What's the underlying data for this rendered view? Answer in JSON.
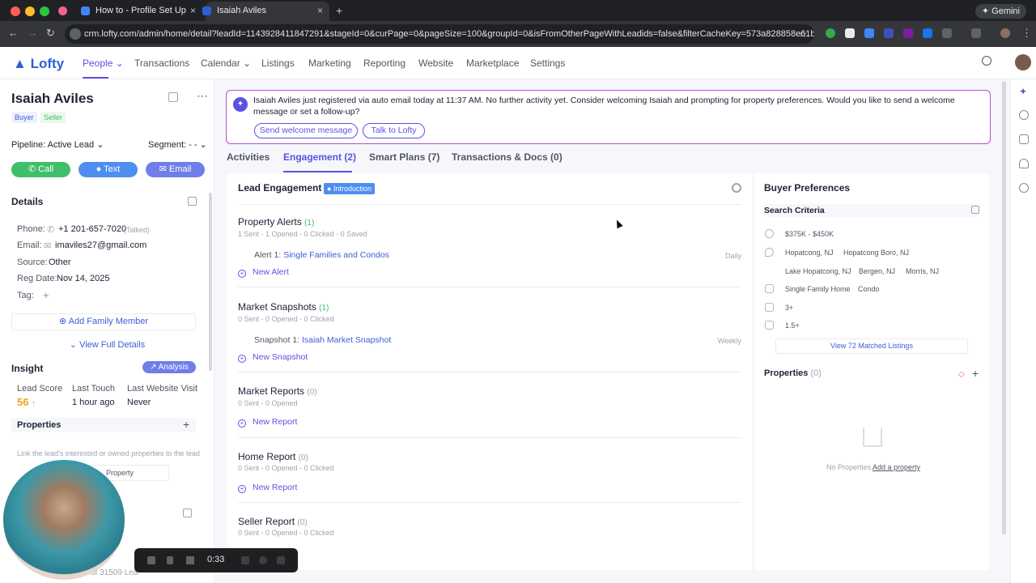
{
  "browser": {
    "tabs": [
      {
        "label": ""
      },
      {
        "label": "How to - Profile Set Up"
      },
      {
        "label": "Isaiah Aviles"
      }
    ],
    "url": "crm.lofty.com/admin/home/detail?leadId=1143928411847291&stageId=0&curPage=0&pageSize=100&groupId=0&isFromOtherPageWithLeadids=false&filterCacheKey=573a828858e61bcfb838249...",
    "gemini_label": "Gemini"
  },
  "app": {
    "logo": "Lofty",
    "nav": [
      "People",
      "Transactions",
      "Calendar",
      "Listings",
      "Marketing",
      "Reporting",
      "Website",
      "Marketplace",
      "Settings"
    ]
  },
  "lead": {
    "name": "Isaiah Aviles",
    "tags": [
      "Buyer",
      "Seller"
    ],
    "pipeline": "Pipeline: Active Lead",
    "segment": "Segment: - -",
    "actions": {
      "call": "Call",
      "text": "Text",
      "email": "Email"
    },
    "details_title": "Details",
    "phone_label": "Phone:",
    "phone": "+1 201-657-7020",
    "phone_status": "(Talked)",
    "email_label": "Email:",
    "email": "imaviles27@gmail.com",
    "source_label": "Source:",
    "source": "Other",
    "reg_label": "Reg Date:",
    "reg_date": "Nov 14, 2025",
    "tag_label": "Tag:",
    "add_family": "Add Family Member",
    "view_full": "View Full Details",
    "insight_title": "Insight",
    "analysis": "Analysis",
    "lead_score_label": "Lead Score",
    "lead_score": "56",
    "last_touch_label": "Last Touch",
    "last_touch": "1 hour ago",
    "last_visit_label": "Last Website Visit",
    "last_visit": "Never",
    "properties_title": "Properties",
    "properties_hint": "Link the lead's interested or owned properties to the lead",
    "property_btn": "Property",
    "pager_text": "of 31509 Lea"
  },
  "banner": {
    "message": "Isaiah Aviles just registered via auto email today at 11:37 AM. No further activity yet. Consider welcoming Isaiah and prompting for property preferences. Would you like to send a welcome message or set a follow-up?",
    "btn_welcome": "Send welcome message",
    "btn_talk": "Talk to Lofty"
  },
  "tabs": [
    "Activities",
    "Engagement (2)",
    "Smart Plans (7)",
    "Transactions & Docs (0)"
  ],
  "engagement": {
    "title": "Lead Engagement",
    "badge": "Introduction",
    "property_alerts": {
      "title": "Property Alerts",
      "count": "(1)",
      "stats": "1 Sent - 1 Opened - 0 Clicked - 0 Saved",
      "item_prefix": "Alert 1:",
      "item_link": "Single Families and Condos",
      "freq": "Daily",
      "new": "New Alert"
    },
    "market_snapshots": {
      "title": "Market Snapshots",
      "count": "(1)",
      "stats": "0 Sent - 0 Opened - 0 Clicked",
      "item_prefix": "Snapshot 1:",
      "item_link": "Isaiah Market Snapshot",
      "freq": "Weekly",
      "new": "New Snapshot"
    },
    "market_reports": {
      "title": "Market Reports",
      "count": "(0)",
      "stats": "0 Sent - 0 Opened",
      "new": "New Report"
    },
    "home_report": {
      "title": "Home Report",
      "count": "(0)",
      "stats": "0 Sent - 0 Opened - 0 Clicked",
      "new": "New Report"
    },
    "seller_report": {
      "title": "Seller Report",
      "count": "(0)",
      "stats": "0 Sent - 0 Opened - 0 Clicked"
    }
  },
  "buyer": {
    "title": "Buyer Preferences",
    "search_criteria": "Search Criteria",
    "price": "$375K - $450K",
    "locations": [
      "Hopatcong, NJ",
      "Hopatcong Boro, NJ",
      "Lake Hopatcong, NJ",
      "Bergen, NJ",
      "Morris, NJ"
    ],
    "types": [
      "Single Family Home",
      "Condo"
    ],
    "beds": "3+",
    "baths": "1.5+",
    "view_matched": "View 72 Matched Listings",
    "properties_title": "Properties",
    "properties_count": "(0)",
    "no_props": "No Properties.",
    "add_prop": "Add a property"
  },
  "player": {
    "time": "0:33"
  }
}
